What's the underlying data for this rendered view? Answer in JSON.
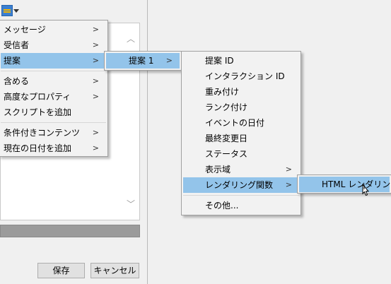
{
  "dialog": {
    "buttons": {
      "save": "保存",
      "cancel": "キャンセル"
    }
  },
  "menu1": {
    "items": [
      {
        "label": "メッセージ",
        "submenu": true
      },
      {
        "label": "受信者",
        "submenu": true
      },
      {
        "label": "提案",
        "submenu": true,
        "highlighted": true
      },
      {
        "label": "含める",
        "submenu": true
      },
      {
        "label": "高度なプロパティ",
        "submenu": true
      },
      {
        "label": "スクリプトを追加",
        "submenu": false
      },
      {
        "label": "条件付きコンテンツ",
        "submenu": true
      },
      {
        "label": "現在の日付を追加",
        "submenu": true
      }
    ]
  },
  "menu2": {
    "items": [
      {
        "label": "提案 1",
        "submenu": true,
        "highlighted": true
      }
    ]
  },
  "menu3": {
    "items": [
      {
        "label": "提案 ID"
      },
      {
        "label": "インタラクション ID"
      },
      {
        "label": "重み付け"
      },
      {
        "label": "ランク付け"
      },
      {
        "label": "イベントの日付"
      },
      {
        "label": "最終変更日"
      },
      {
        "label": "ステータス"
      },
      {
        "label": "表示域",
        "submenu": true
      },
      {
        "label": "レンダリング関数",
        "submenu": true,
        "highlighted": true
      },
      {
        "label": "その他..."
      }
    ]
  },
  "menu4": {
    "items": [
      {
        "label": "HTML レンダリング",
        "highlighted": true
      }
    ]
  },
  "colors": {
    "highlight": "#93c4ea",
    "menu_bg": "#f2f2f2"
  },
  "icons": {
    "submenu_arrow": "chevron-right-icon"
  }
}
